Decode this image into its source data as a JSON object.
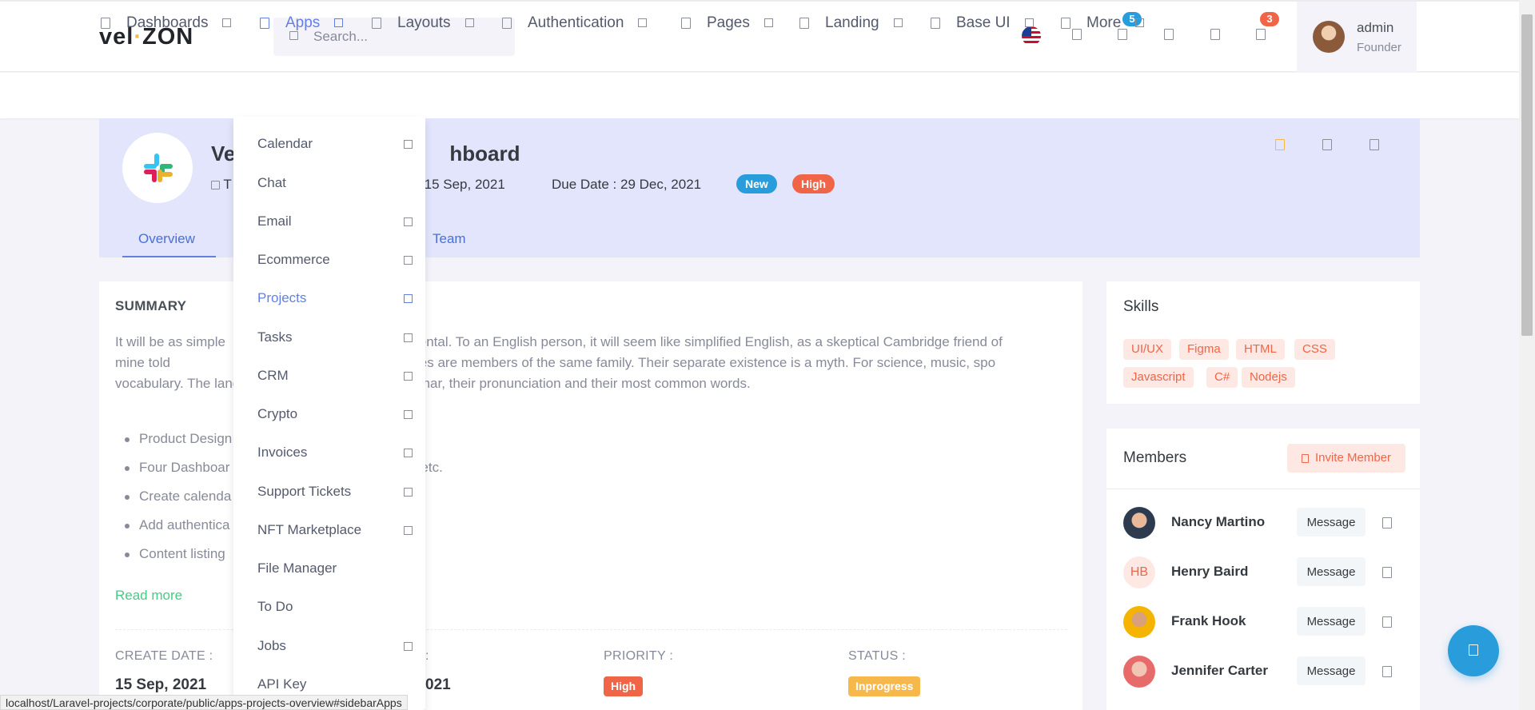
{
  "header": {
    "logo": {
      "pre": "vel",
      "dot": "·",
      "post": "ZON"
    },
    "search_placeholder": "Search...",
    "notifications": {
      "cart_count": "5",
      "bell_count": "3"
    },
    "user": {
      "name": "admin",
      "role": "Founder"
    }
  },
  "nav": {
    "items": [
      {
        "label": "Dashboards"
      },
      {
        "label": "Apps"
      },
      {
        "label": "Layouts"
      },
      {
        "label": "Authentication"
      },
      {
        "label": "Pages"
      },
      {
        "label": "Landing"
      },
      {
        "label": "Base UI"
      },
      {
        "label": "More"
      }
    ]
  },
  "project": {
    "title_start": "Ve",
    "title_end": "hboard",
    "meta_start": "T",
    "meta_create": "e : 15 Sep, 2021",
    "meta_due": "Due Date : 29 Dec, 2021",
    "badge_new": "New",
    "badge_high": "High",
    "tabs": {
      "overview": "Overview",
      "team": "Team"
    }
  },
  "apps_menu": {
    "items": [
      {
        "label": "Calendar",
        "submenu": true
      },
      {
        "label": "Chat",
        "submenu": false
      },
      {
        "label": "Email",
        "submenu": true
      },
      {
        "label": "Ecommerce",
        "submenu": true
      },
      {
        "label": "Projects",
        "submenu": true
      },
      {
        "label": "Tasks",
        "submenu": true
      },
      {
        "label": "CRM",
        "submenu": true
      },
      {
        "label": "Crypto",
        "submenu": true
      },
      {
        "label": "Invoices",
        "submenu": true
      },
      {
        "label": "Support Tickets",
        "submenu": true
      },
      {
        "label": "NFT Marketplace",
        "submenu": true
      },
      {
        "label": "File Manager",
        "submenu": false
      },
      {
        "label": "To Do",
        "submenu": false
      },
      {
        "label": "Jobs",
        "submenu": true
      },
      {
        "label": "API Key",
        "submenu": false
      }
    ]
  },
  "summary": {
    "title": "SUMMARY",
    "paragraph": "It will be as simple                                       e Occidental. To an English person, it will seem like simplified English, as a skeptical Cambridge friend of mine told                                       uropean languages are members of the same family. Their separate existence is a myth. For science, music, spo                                       vocabulary. The languages only differ in their grammar, their pronunciation and their most common words.",
    "bullets": [
      "Product Design",
      "Four Dashboar                                          oject,etc.",
      "Create calenda",
      "Add authentica",
      "Content listing"
    ],
    "read_more": "Read more",
    "fields": {
      "create_label": "CREATE DATE :",
      "create_value": "15 Sep, 2021",
      "due_label": ":",
      "due_value": "021",
      "priority_label": "PRIORITY :",
      "priority_value": "High",
      "status_label": "STATUS :",
      "status_value": "Inprogress"
    }
  },
  "skills": {
    "title": "Skills",
    "chips": [
      "UI/UX",
      "Figma",
      "HTML",
      "CSS",
      "Javascript",
      "C#",
      "Nodejs"
    ]
  },
  "members": {
    "title": "Members",
    "invite_label": "Invite Member",
    "message_label": "Message",
    "list": [
      {
        "name": "Nancy Martino"
      },
      {
        "name": "Henry Baird",
        "initials": "HB"
      },
      {
        "name": "Frank Hook"
      },
      {
        "name": "Jennifer Carter"
      }
    ]
  },
  "status_url": "localhost/Laravel-projects/corporate/public/apps-projects-overview#sidebarApps",
  "colors": {
    "primary": "#6380e4",
    "success": "#45cb85",
    "danger": "#f06548",
    "info": "#299cdb",
    "warning": "#f7b84b",
    "header_bg": "#e2e5fb"
  }
}
